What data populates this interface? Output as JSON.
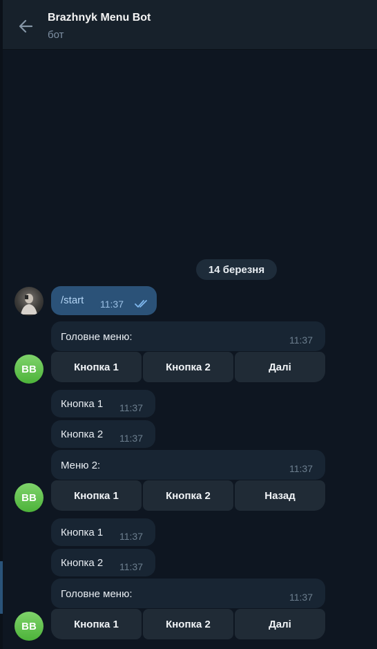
{
  "header": {
    "title": "Brazhnyk Menu Bot",
    "subtitle": "бот"
  },
  "date_separator": "14 березня",
  "bot_avatar_initials": "BB",
  "messages": [
    {
      "type": "outgoing",
      "text": "/start",
      "time": "11:37",
      "status": "read"
    },
    {
      "type": "incoming",
      "text": "Головне меню:",
      "time": "11:37",
      "buttons": [
        "Кнопка 1",
        "Кнопка 2",
        "Далі"
      ]
    },
    {
      "type": "incoming",
      "text": "Кнопка 1",
      "time": "11:37"
    },
    {
      "type": "incoming",
      "text": "Кнопка 2",
      "time": "11:37"
    },
    {
      "type": "incoming",
      "text": "Меню 2:",
      "time": "11:37",
      "buttons": [
        "Кнопка 1",
        "Кнопка 2",
        "Назад"
      ]
    },
    {
      "type": "incoming",
      "text": "Кнопка 1",
      "time": "11:37"
    },
    {
      "type": "incoming",
      "text": "Кнопка 2",
      "time": "11:37"
    },
    {
      "type": "incoming",
      "text": "Головне меню:",
      "time": "11:37",
      "buttons": [
        "Кнопка 1",
        "Кнопка 2",
        "Далі"
      ]
    }
  ],
  "colors": {
    "background": "#0e1621",
    "header": "#17212b",
    "incoming_bubble": "#182533",
    "outgoing_bubble": "#2b5278",
    "bot_avatar": "#4db33a"
  },
  "icons": {
    "back": "arrow-left-icon",
    "read_status": "double-check-icon"
  }
}
